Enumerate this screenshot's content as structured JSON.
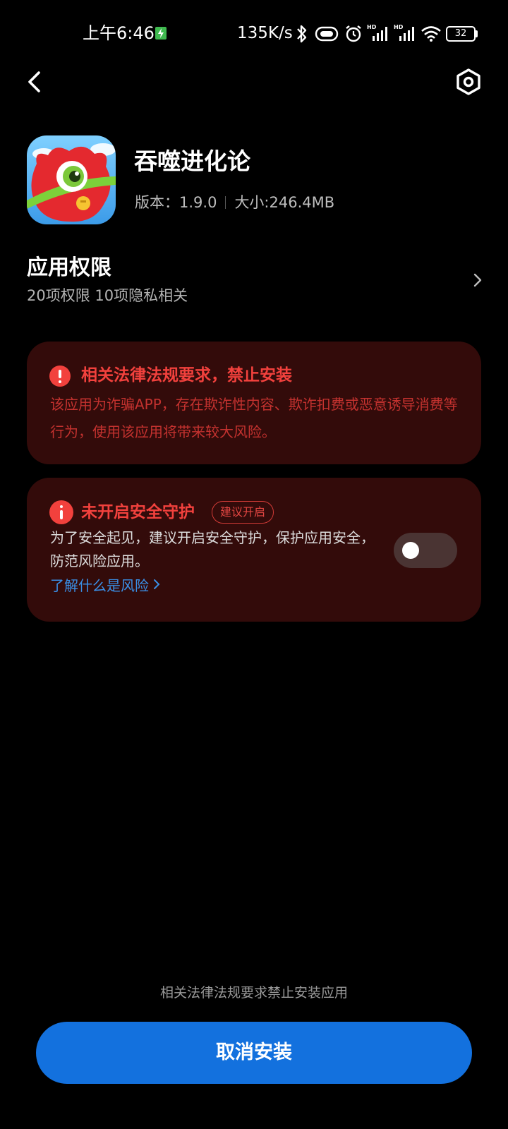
{
  "status_bar": {
    "time": "上午6:46",
    "net_speed": "135K/s",
    "battery": "32",
    "signal_1_badge": "HD",
    "signal_2_badge": "HD"
  },
  "nav": {
    "back_icon": "chevron-left-icon",
    "settings_icon": "hexagon-gear-icon"
  },
  "app": {
    "name": "吞噬进化论",
    "version": "版本：1.9.0",
    "size": "大小:246.4MB"
  },
  "permissions": {
    "title": "应用权限",
    "summary": "20项权限 10项隐私相关"
  },
  "ban_card": {
    "title": "相关法律法规要求，禁止安装",
    "body": "该应用为诈骗APP，存在欺诈性内容、欺诈扣费或恶意诱导消费等行为，使用该应用将带来较大风险。"
  },
  "guard_card": {
    "title": "未开启安全守护",
    "badge": "建议开启",
    "body": "为了安全起见，建议开启安全守护，保护应用安全，防范风险应用。",
    "link": "了解什么是风险",
    "toggle_on": false
  },
  "footer": {
    "note": "相关法律法规要求禁止安装应用",
    "cancel_label": "取消安装"
  },
  "colors": {
    "accent_blue": "#1371de",
    "danger_red": "#f2413d",
    "card_bg": "#330b0a",
    "link_blue": "#3a8fe6"
  }
}
